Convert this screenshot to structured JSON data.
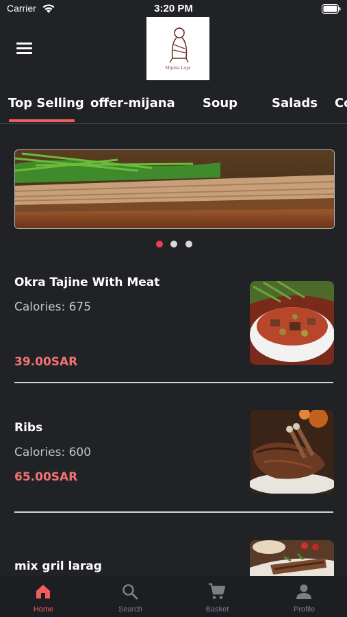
{
  "status_bar": {
    "carrier": "Carrier",
    "time": "3:20 PM",
    "icons": [
      "wifi-icon",
      "battery-icon"
    ]
  },
  "header": {
    "menu_icon": "hamburger-menu-icon",
    "logo_text": "Mijana Lays"
  },
  "tabs": {
    "items": [
      {
        "label": "Top Selling",
        "active": true
      },
      {
        "label": "offer-mijana",
        "active": false
      },
      {
        "label": "Soup",
        "active": false
      },
      {
        "label": "Salads",
        "active": false
      },
      {
        "label": "Co",
        "active": false
      }
    ],
    "accent": "#f05d5e"
  },
  "carousel": {
    "slide_count": 3,
    "active_index": 0
  },
  "items": [
    {
      "name": "Okra Tajine With Meat",
      "calories": "Calories: 675",
      "price": "39.00SAR"
    },
    {
      "name": "Ribs",
      "calories": "Calories: 600",
      "price": "65.00SAR"
    },
    {
      "name": "mix gril larag",
      "calories": "",
      "price": ""
    }
  ],
  "bottom_nav": {
    "items": [
      {
        "label": "Home",
        "icon": "home-icon",
        "active": true
      },
      {
        "label": "Search",
        "icon": "search-icon",
        "active": false
      },
      {
        "label": "Basket",
        "icon": "cart-icon",
        "active": false
      },
      {
        "label": "Profile",
        "icon": "profile-icon",
        "active": false
      }
    ]
  },
  "colors": {
    "background": "#202226",
    "accent": "#f05d5e",
    "price": "#f07272",
    "active_dot": "#ea3f5a"
  }
}
